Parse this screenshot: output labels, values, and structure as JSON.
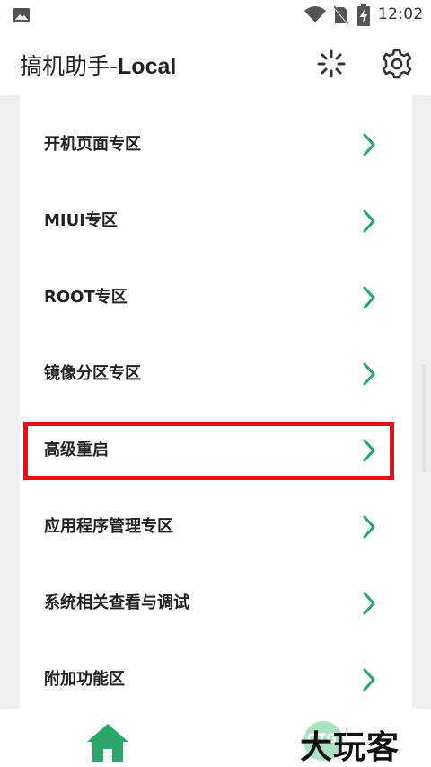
{
  "status_bar": {
    "time": "12:02",
    "icons": [
      "gallery-icon",
      "wifi-icon",
      "no-sim-icon",
      "battery-charging-icon"
    ]
  },
  "app_bar": {
    "title_cjk": "搞机助手-",
    "title_latin": "Local",
    "actions": [
      "loading-icon",
      "gear-icon"
    ]
  },
  "menu": {
    "items": [
      {
        "label": "开机页面专区"
      },
      {
        "label": "MIUI专区"
      },
      {
        "label": "ROOT专区"
      },
      {
        "label": "镜像分区专区"
      },
      {
        "label": "高级重启"
      },
      {
        "label": "应用程序管理专区"
      },
      {
        "label": "系统相关查看与调试"
      },
      {
        "label": "附加功能区"
      }
    ],
    "highlighted_item": "高级重启"
  },
  "bottom_nav": {
    "home_icon": "home-icon"
  },
  "watermark": {
    "text": "大玩客",
    "badge": "OTG"
  },
  "colors": {
    "accent_green": "#2aa66a",
    "highlight_red": "#e2101a",
    "background_gray": "#efefef",
    "text_dark": "#222222"
  }
}
